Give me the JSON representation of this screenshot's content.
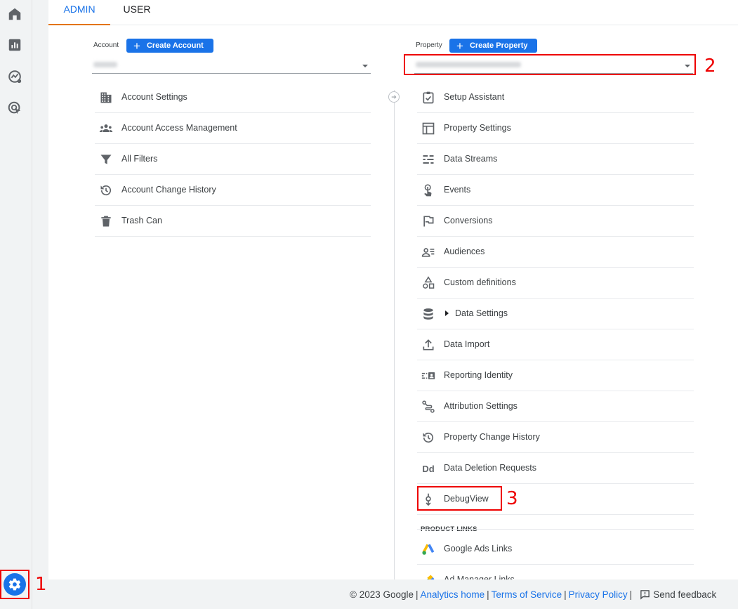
{
  "tabs": {
    "admin": "ADMIN",
    "user": "USER"
  },
  "account": {
    "label": "Account",
    "create_button": "Create Account",
    "create_icon": "+",
    "menu": [
      {
        "icon": "building-icon",
        "label": "Account Settings"
      },
      {
        "icon": "people-icon",
        "label": "Account Access Management"
      },
      {
        "icon": "filter-icon",
        "label": "All Filters"
      },
      {
        "icon": "history-icon",
        "label": "Account Change History"
      },
      {
        "icon": "trash-icon",
        "label": "Trash Can"
      }
    ]
  },
  "property": {
    "label": "Property",
    "create_button": "Create Property",
    "create_icon": "+",
    "menu": [
      {
        "icon": "checklist-icon",
        "label": "Setup Assistant"
      },
      {
        "icon": "layout-icon",
        "label": "Property Settings"
      },
      {
        "icon": "streams-icon",
        "label": "Data Streams"
      },
      {
        "icon": "touch-icon",
        "label": "Events"
      },
      {
        "icon": "flag-icon",
        "label": "Conversions"
      },
      {
        "icon": "audience-icon",
        "label": "Audiences"
      },
      {
        "icon": "shapes-icon",
        "label": "Custom definitions"
      },
      {
        "icon": "database-icon",
        "label": "Data Settings"
      },
      {
        "icon": "upload-icon",
        "label": "Data Import"
      },
      {
        "icon": "identity-icon",
        "label": "Reporting Identity"
      },
      {
        "icon": "attribution-icon",
        "label": "Attribution Settings"
      },
      {
        "icon": "history-icon",
        "label": "Property Change History"
      },
      {
        "icon": "dd-icon",
        "label": "Data Deletion Requests",
        "icon_text": "Dd"
      },
      {
        "icon": "debug-icon",
        "label": "DebugView"
      }
    ],
    "product_links_heading": "PRODUCT LINKS",
    "product_links": [
      {
        "icon": "google-ads-icon",
        "label": "Google Ads Links"
      },
      {
        "icon": "ad-manager-icon",
        "label": "Ad Manager Links"
      }
    ]
  },
  "callouts": {
    "one": "1",
    "two": "2",
    "three": "3"
  },
  "footer": {
    "copyright": "© 2023 Google",
    "sep": "|",
    "analytics_home": "Analytics home",
    "terms": "Terms of Service",
    "privacy": "Privacy Policy",
    "feedback": "Send feedback"
  },
  "colors": {
    "accent": "#1a73e8",
    "active_tab_underline": "#e37400",
    "callout": "#e00000"
  }
}
